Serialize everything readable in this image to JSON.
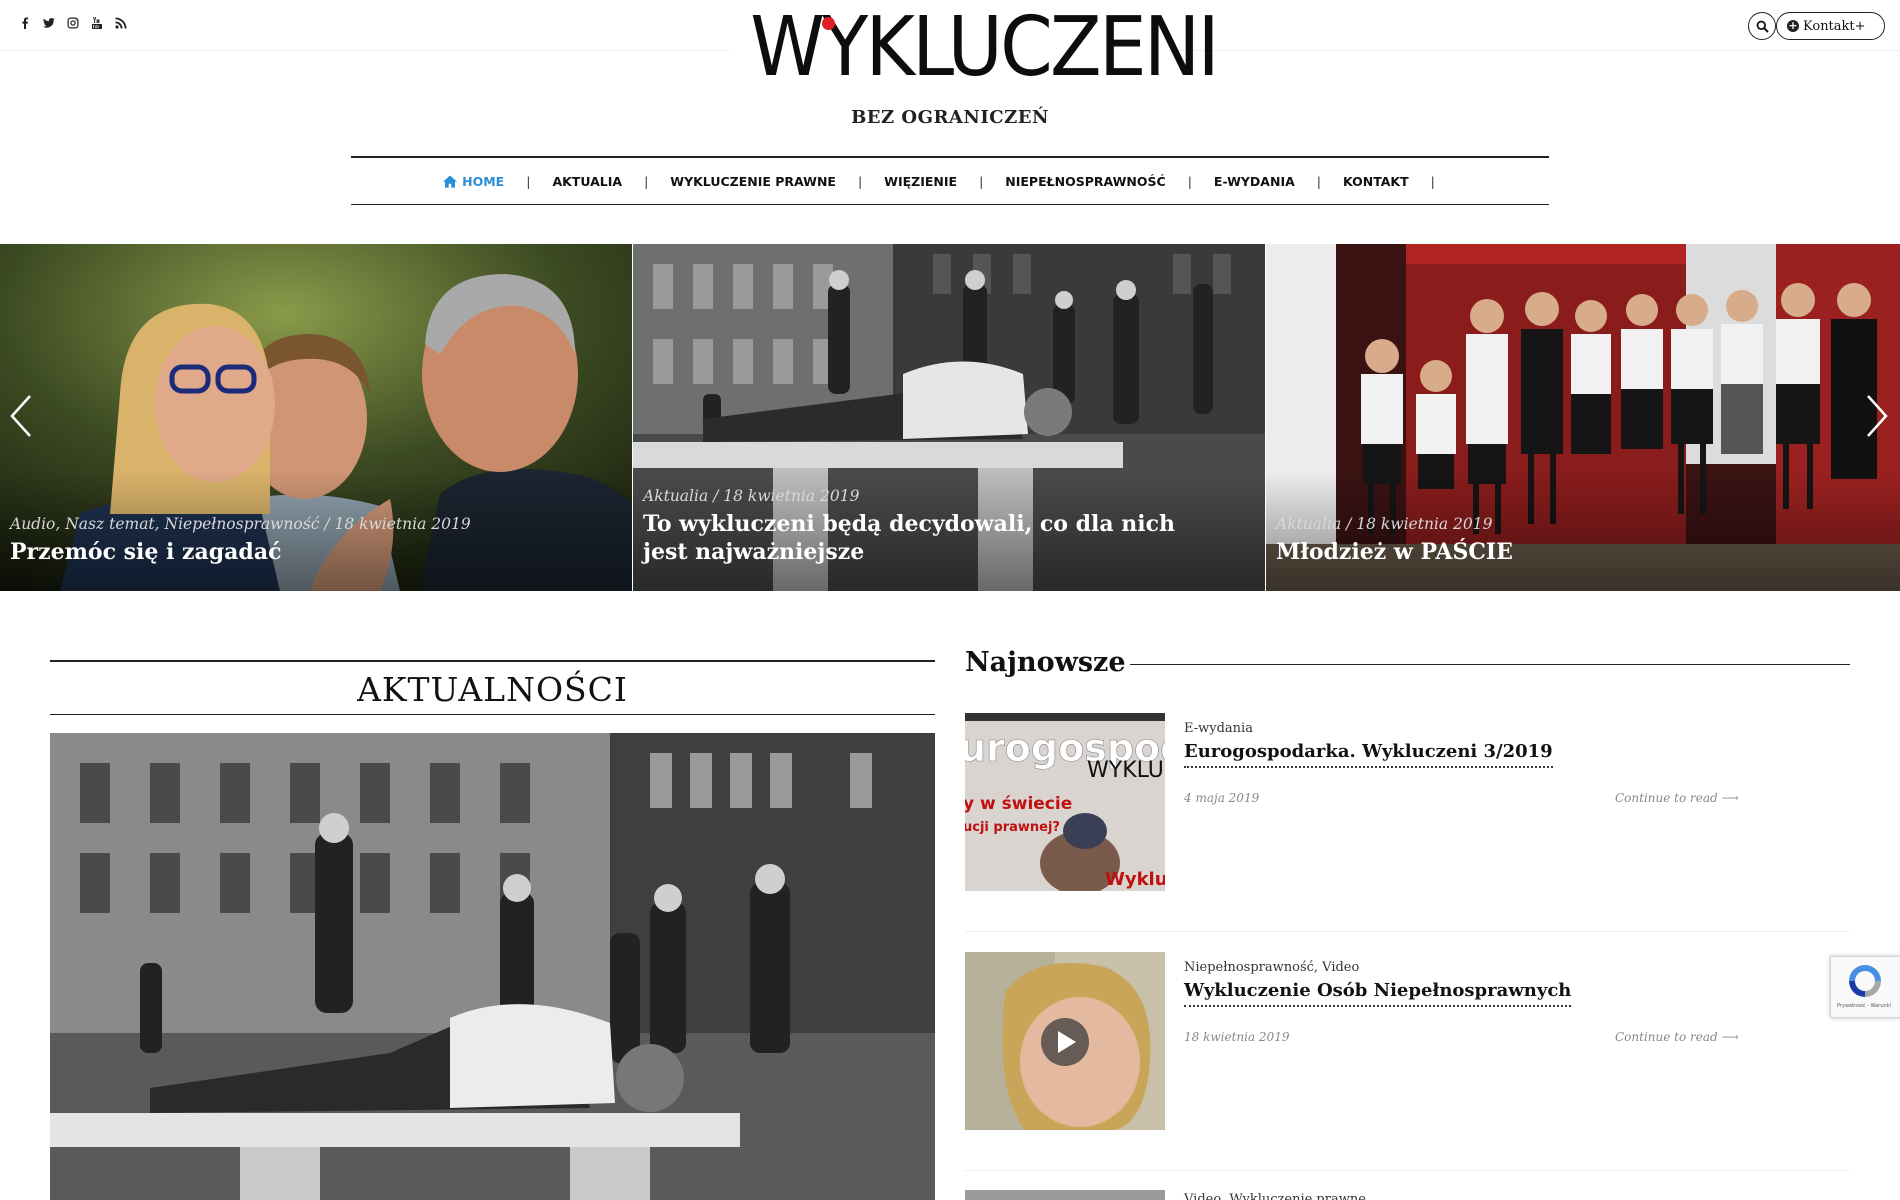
{
  "header": {
    "social": [
      {
        "icon": "facebook-icon"
      },
      {
        "icon": "twitter-icon"
      },
      {
        "icon": "instagram-icon"
      },
      {
        "icon": "youtube-icon"
      },
      {
        "icon": "rss-icon"
      }
    ],
    "logo_text": "WYKLUCZENI",
    "tagline": "BEZ OGRANICZEŃ",
    "contact_label": "Kontakt+",
    "brand_color": "#e11d24"
  },
  "nav": {
    "items": [
      {
        "label": "HOME",
        "active": true
      },
      {
        "label": "AKTUALIA"
      },
      {
        "label": "WYKLUCZENIE PRAWNE"
      },
      {
        "label": "WIĘZIENIE"
      },
      {
        "label": "NIEPEŁNOSPRAWNOŚĆ"
      },
      {
        "label": "E-WYDANIA"
      },
      {
        "label": "KONTAKT"
      }
    ],
    "separator": "|",
    "active_color": "#2a8fd6"
  },
  "slider": {
    "slides": [
      {
        "meta": "Audio, Nasz temat, Niepełnosprawność / 18 kwietnia 2019",
        "title": "Przemóc się i zagadać"
      },
      {
        "meta": "Aktualia / 18 kwietnia 2019",
        "title": "To wykluczeni będą decydowali, co dla nich jest najważniejsze"
      },
      {
        "meta": "Aktualia / 18 kwietnia 2019",
        "title": "Młodzież w PAŚCIE"
      }
    ]
  },
  "aktualnosci": {
    "heading": "AKTUALNOŚCI"
  },
  "najnowsze": {
    "heading": "Najnowsze",
    "posts": [
      {
        "category": "E-wydania",
        "title": "Eurogospodarka. Wykluczeni 3/2019",
        "date": "4 maja 2019",
        "more": "Continue to read ⟶",
        "thumb_text": "urogospoda",
        "thumb_text2": "WYKLU",
        "thumb_text3": "y w świecie",
        "thumb_text4": "ucji prawnej?",
        "thumb_text5": "Wyklu"
      },
      {
        "category": "Niepełnosprawność, Video",
        "title": "Wykluczenie Osób Niepełnosprawnych",
        "date": "18 kwietnia 2019",
        "more": "Continue to read ⟶"
      },
      {
        "category": "Video, Wykluczenie prawne"
      }
    ]
  },
  "recaptcha": {
    "label": "Prywatność - Warunki"
  }
}
